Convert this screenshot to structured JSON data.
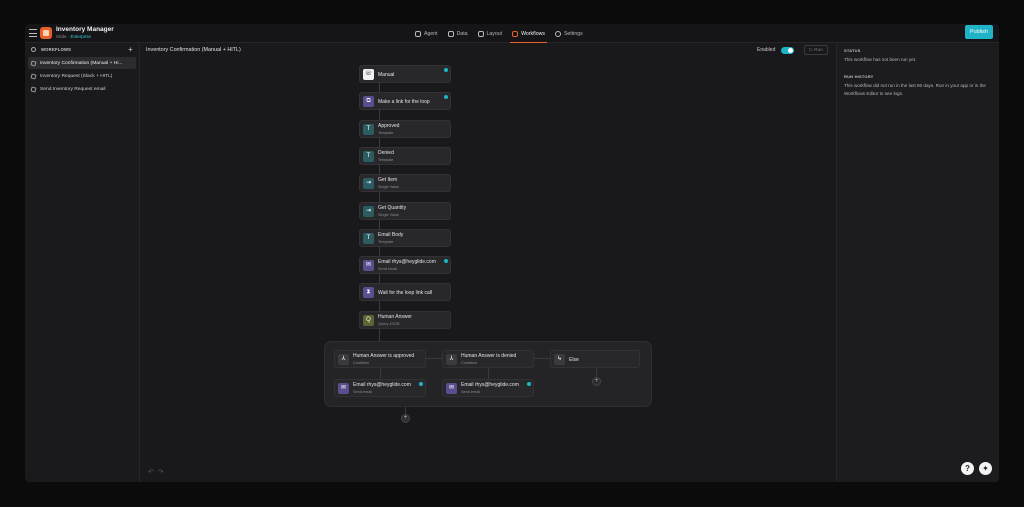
{
  "app": {
    "title": "Inventory Manager",
    "subtitle": "Glide ·",
    "plan": "Enterprise"
  },
  "nav": [
    {
      "label": "Agent",
      "icon": "agent-icon"
    },
    {
      "label": "Data",
      "icon": "data-icon"
    },
    {
      "label": "Layout",
      "icon": "layout-icon"
    },
    {
      "label": "Workflows",
      "icon": "workflows-icon",
      "active": true
    },
    {
      "label": "Settings",
      "icon": "settings-icon"
    }
  ],
  "publish_label": "Publish",
  "sidebar": {
    "heading": "WORKFLOWS",
    "items": [
      {
        "label": "Inventory Confirmation (Manual + Hi..."
      },
      {
        "label": "Inventory Request (Slack + HITL)"
      },
      {
        "label": "Send Inventory Request email"
      }
    ]
  },
  "canvas": {
    "title": "Inventory Confirmation (Manual + HITL)",
    "enabled_label": "Enabled",
    "run_label": "Run",
    "nodes": [
      {
        "title": "Manual",
        "sub": "",
        "icon": "phone-icon",
        "glyph": "☏",
        "color": "white",
        "dot": true
      },
      {
        "title": "Make a link for the loop",
        "sub": "",
        "icon": "link-icon",
        "glyph": "⧉",
        "color": "purple",
        "dot": true
      },
      {
        "title": "Approved",
        "sub": "Template",
        "icon": "template-icon",
        "glyph": "T",
        "color": "teal"
      },
      {
        "title": "Denied",
        "sub": "Template",
        "icon": "template-icon",
        "glyph": "T",
        "color": "teal"
      },
      {
        "title": "Get Item",
        "sub": "Single Value",
        "icon": "single-value-icon",
        "glyph": "⇥",
        "color": "teal"
      },
      {
        "title": "Get Quantity",
        "sub": "Single Value",
        "icon": "single-value-icon",
        "glyph": "⇥",
        "color": "teal"
      },
      {
        "title": "Email Body",
        "sub": "Template",
        "icon": "template-icon",
        "glyph": "T",
        "color": "teal"
      },
      {
        "title": "Email rhys@heyglide.com",
        "sub": "Send email",
        "icon": "send-email-icon",
        "glyph": "✉",
        "color": "purple",
        "dot": true
      },
      {
        "title": "Wait for the loop link call",
        "sub": "",
        "icon": "wait-icon",
        "glyph": "⧗",
        "color": "purple"
      },
      {
        "title": "Human Answer",
        "sub": "Query JSON",
        "icon": "query-json-icon",
        "glyph": "Q",
        "color": "olive"
      }
    ],
    "branches": [
      {
        "title": "Human Answer is approved",
        "sub": "Condition",
        "icon": "condition-icon",
        "glyph": "⅄"
      },
      {
        "title": "Human Answer is denied",
        "sub": "Condition",
        "icon": "condition-icon",
        "glyph": "⅄"
      },
      {
        "title": "Else",
        "sub": "",
        "icon": "else-icon",
        "glyph": "↳"
      }
    ],
    "branch_actions": [
      {
        "title": "Email rhys@heyglide.com",
        "sub": "Send email",
        "icon": "send-email-icon",
        "glyph": "✉"
      },
      {
        "title": "Email rhys@heyglide.com",
        "sub": "Send email",
        "icon": "send-email-icon",
        "glyph": "✉"
      }
    ]
  },
  "panel": {
    "status_heading": "STATUS",
    "status_text": "This workflow has not been run yet.",
    "history_heading": "RUN HISTORY",
    "history_text": "This workflow did not run in the last 90 days. Run in your app or in the Workflows Editor to see logs."
  }
}
